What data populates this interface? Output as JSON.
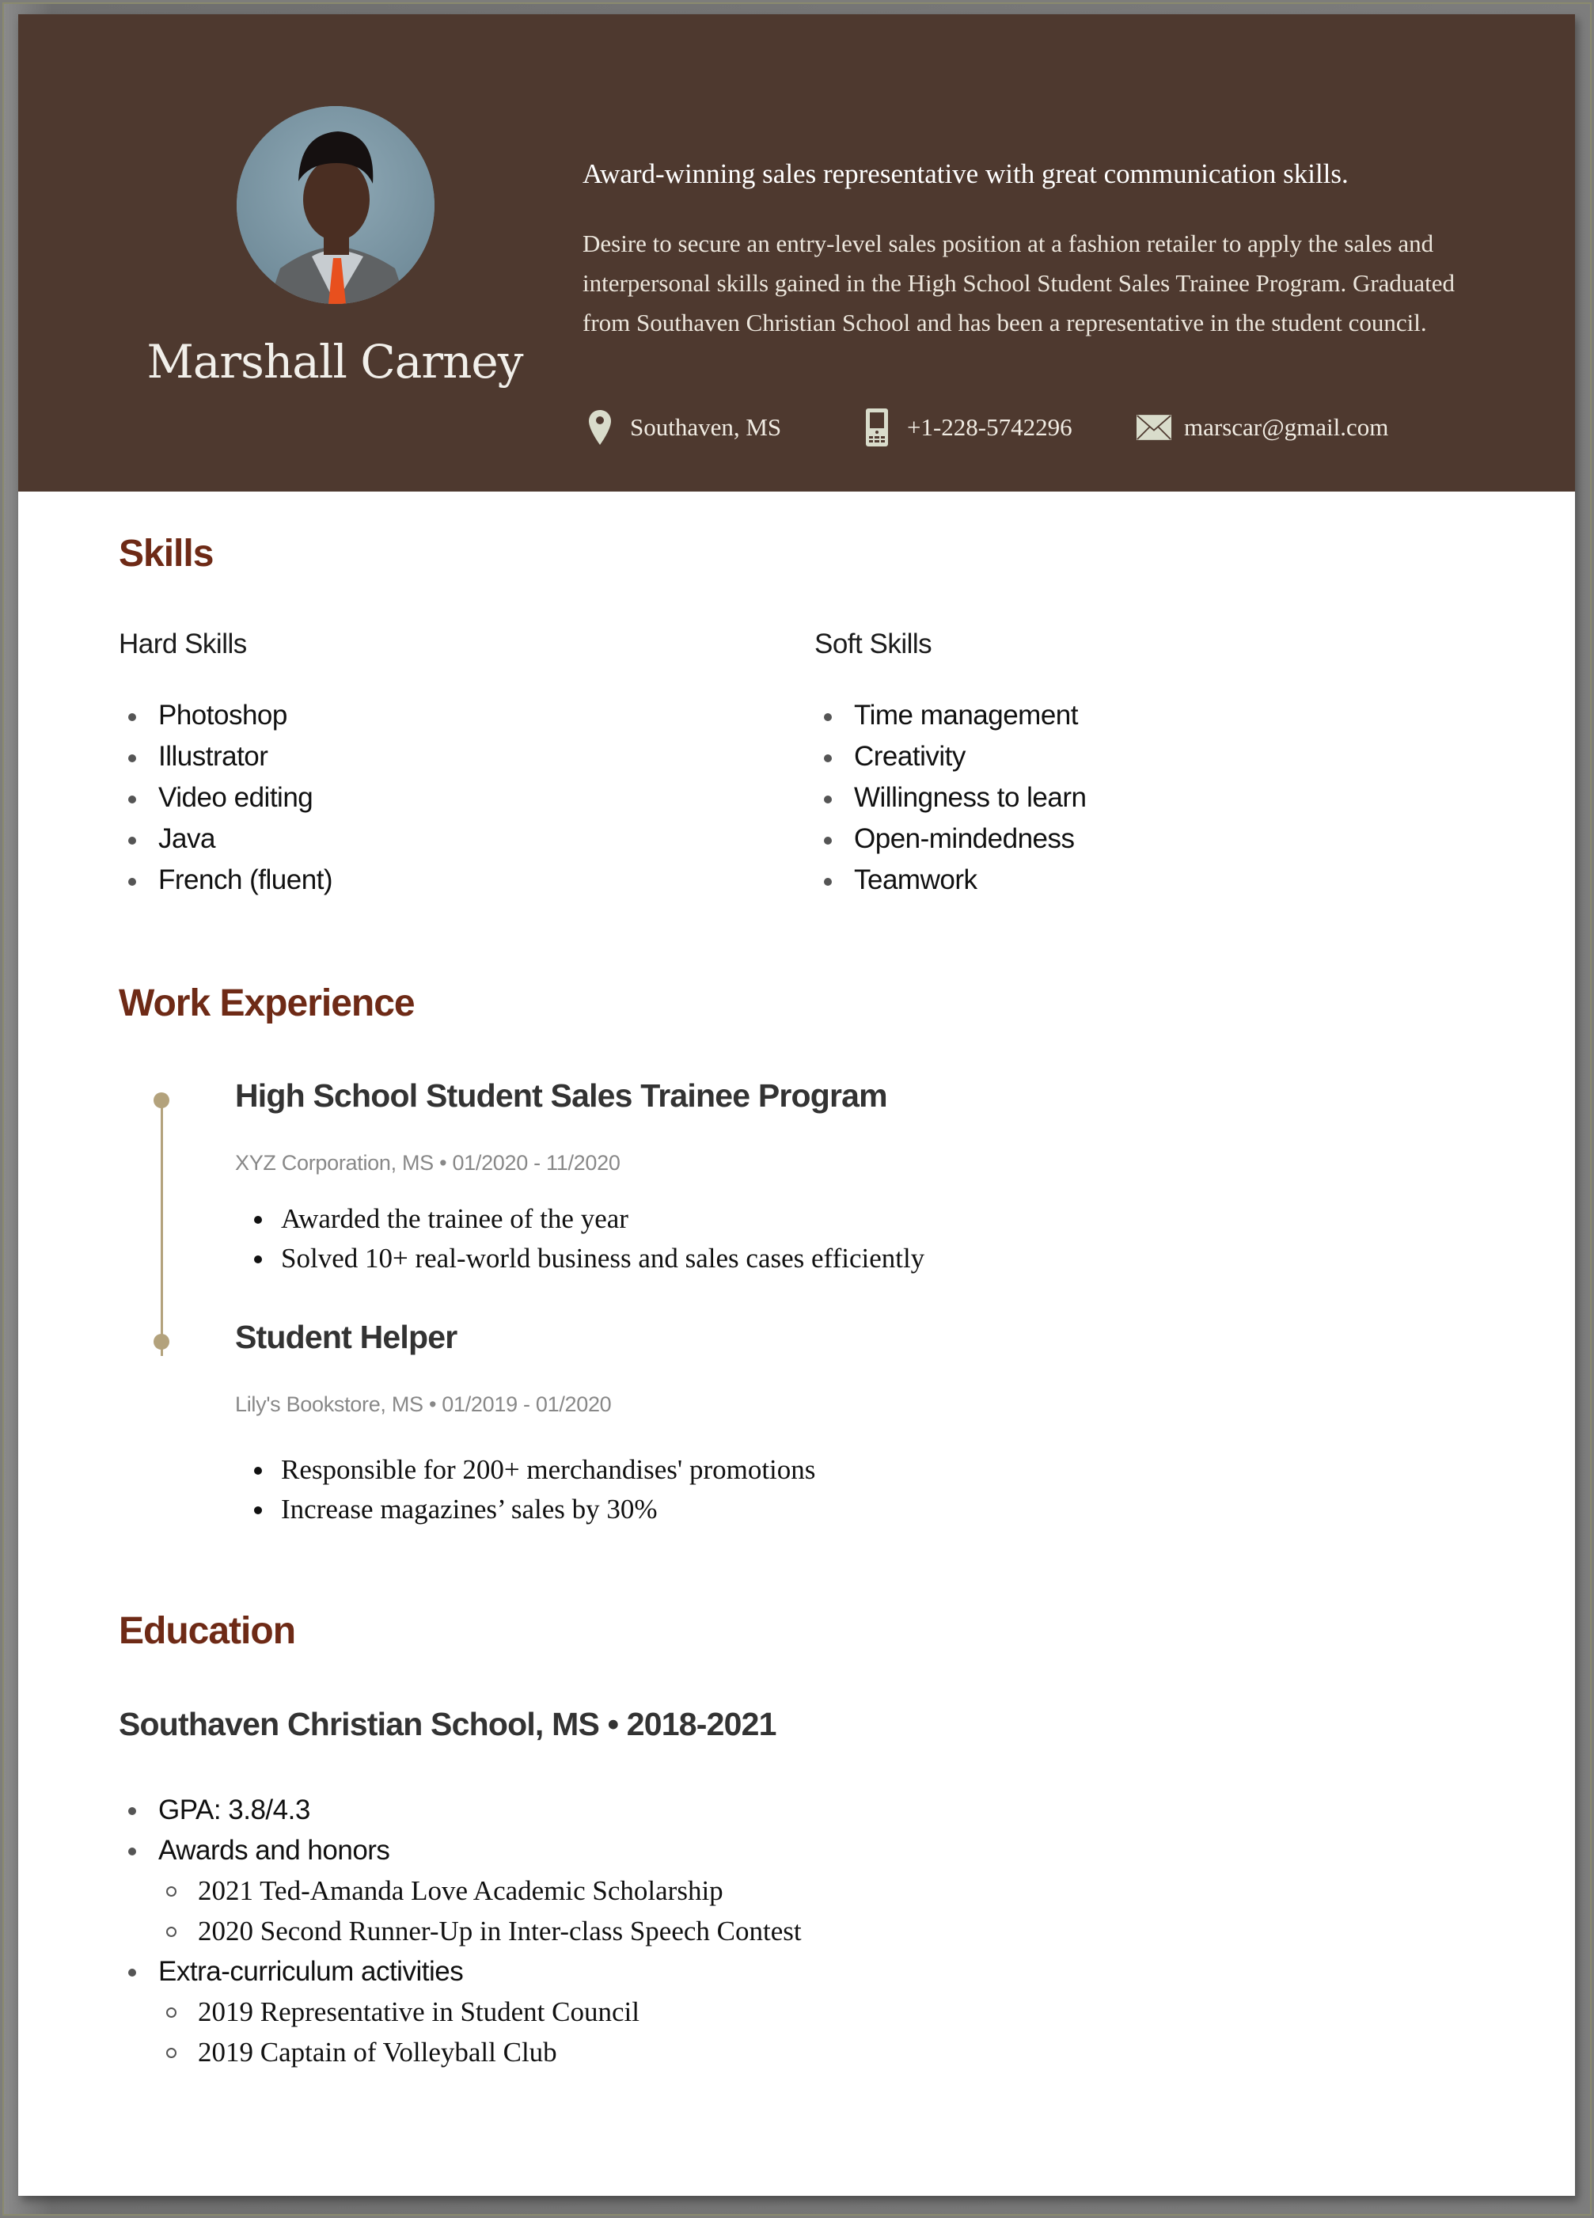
{
  "header": {
    "name": "Marshall Carney",
    "photo_alt": "profile-photo",
    "summary_title": "Award-winning sales representative with great communication skills.",
    "summary_text": "Desire to secure an entry-level sales position at a fashion retailer to apply the sales and interpersonal skills gained in the High School Student Sales Trainee Program. Graduated from Southaven Christian School and has been a representative in the student council.",
    "contacts": {
      "location": {
        "icon": "location-pin-icon",
        "text": "Southaven, MS"
      },
      "phone": {
        "icon": "mobile-phone-icon",
        "text": "+1-228-5742296"
      },
      "email": {
        "icon": "envelope-icon",
        "text": "marscar@gmail.com"
      }
    }
  },
  "colors": {
    "header_bg": "#4e392f",
    "section_heading": "#6e2a16",
    "timeline": "#b3a27c",
    "icon_fill": "#d9dccb"
  },
  "skills": {
    "heading": "Skills",
    "hard": {
      "label": "Hard Skills",
      "items": [
        "Photoshop",
        "Illustrator",
        "Video editing",
        "Java",
        "French (fluent)"
      ]
    },
    "soft": {
      "label": "Soft Skills",
      "items": [
        "Time management",
        "Creativity",
        "Willingness to learn",
        "Open-mindedness",
        "Teamwork"
      ]
    }
  },
  "work": {
    "heading": "Work Experience",
    "jobs": [
      {
        "title": "High School Student Sales Trainee Program",
        "meta": "XYZ Corporation, MS • 01/2020 - 11/2020",
        "bullets": [
          "Awarded the trainee of the year",
          "Solved 10+ real-world business and sales cases efficiently"
        ]
      },
      {
        "title": "Student Helper",
        "meta": "Lily's Bookstore, MS • 01/2019 - 01/2020",
        "bullets": [
          "Responsible for 200+ merchandises' promotions",
          "Increase magazines’ sales by 30%"
        ]
      }
    ]
  },
  "education": {
    "heading": "Education",
    "school": "Southaven Christian School, MS  • 2018-2021",
    "items": [
      {
        "text": "GPA: 3.8/4.3",
        "sub": []
      },
      {
        "text": "Awards and honors",
        "sub": [
          "2021 Ted-Amanda Love Academic Scholarship",
          "2020 Second Runner-Up in Inter-class Speech Contest"
        ]
      },
      {
        "text": "Extra-curriculum activities",
        "sub": [
          "2019 Representative in Student Council",
          "2019 Captain of Volleyball Club"
        ]
      }
    ]
  }
}
